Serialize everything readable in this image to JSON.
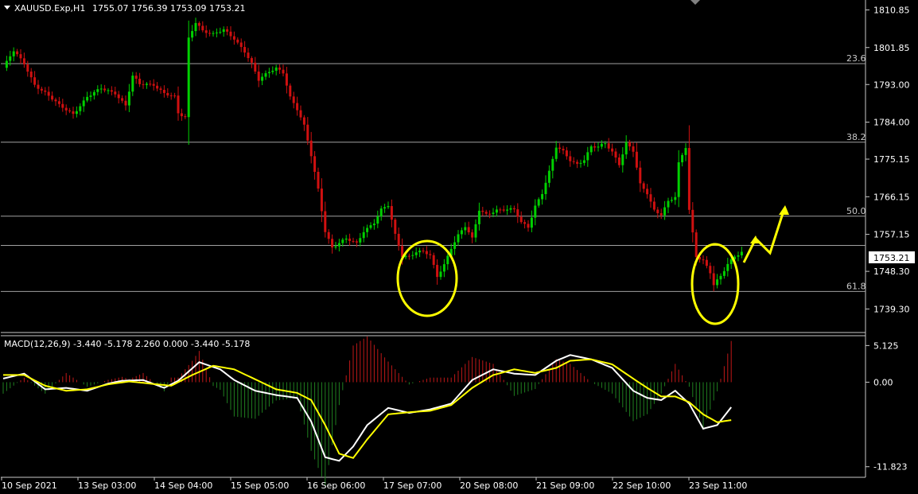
{
  "header": {
    "symbol": "XAUUSD.Exp,H1",
    "ohlc": "1755.07 1756.39 1753.09 1753.21"
  },
  "colors": {
    "background": "#000000",
    "bull": "#00d000",
    "bear": "#d01010",
    "fib_line": "#a0a0a0",
    "macd_line": "#ffffff",
    "signal_line": "#ffff00",
    "hist_pos": "#c01818",
    "hist_neg": "#208020",
    "highlight": "#ffff00",
    "price_box": "#ffffff"
  },
  "chart_data": [
    {
      "type": "candlestick",
      "title": "XAUUSD.Exp,H1",
      "y_ticks": [
        "1810.85",
        "1801.85",
        "1793.00",
        "1784.00",
        "1775.15",
        "1766.15",
        "1757.15",
        "1748.30",
        "1739.30"
      ],
      "ylim": [
        1736.9,
        1811.7
      ],
      "x_ticks": [
        "10 Sep 2021",
        "13 Sep 03:00",
        "14 Sep 04:00",
        "15 Sep 05:00",
        "16 Sep 06:00",
        "17 Sep 07:00",
        "20 Sep 08:00",
        "21 Sep 09:00",
        "22 Sep 10:00",
        "23 Sep 11:00"
      ],
      "current_price": "1753.21",
      "fib_levels": [
        {
          "label": "23.6",
          "price": 1798.0
        },
        {
          "label": "38.2",
          "price": 1779.2
        },
        {
          "label": "50.0",
          "price": 1761.5
        },
        {
          "label": "",
          "price": 1754.5
        },
        {
          "label": "61.8",
          "price": 1743.5
        }
      ],
      "anchors": [
        [
          0,
          1797
        ],
        [
          3,
          1801
        ],
        [
          6,
          1798
        ],
        [
          9,
          1793
        ],
        [
          12,
          1791
        ],
        [
          16,
          1788
        ],
        [
          20,
          1786
        ],
        [
          24,
          1790
        ],
        [
          28,
          1792
        ],
        [
          32,
          1791
        ],
        [
          35,
          1788
        ],
        [
          37,
          1795
        ],
        [
          39,
          1793
        ],
        [
          43,
          1793
        ],
        [
          46,
          1791
        ],
        [
          49,
          1790
        ],
        [
          50,
          1786
        ],
        [
          52,
          1785
        ],
        [
          53,
          1804
        ],
        [
          55,
          1808
        ],
        [
          57,
          1806
        ],
        [
          60,
          1805
        ],
        [
          63,
          1806
        ],
        [
          66,
          1804
        ],
        [
          69,
          1801
        ],
        [
          71,
          1798
        ],
        [
          73,
          1794
        ],
        [
          76,
          1796
        ],
        [
          78,
          1797
        ],
        [
          80,
          1796
        ],
        [
          82,
          1790
        ],
        [
          84,
          1787
        ],
        [
          86,
          1783
        ],
        [
          88,
          1776
        ],
        [
          90,
          1768
        ],
        [
          92,
          1758
        ],
        [
          94,
          1754
        ],
        [
          96,
          1755
        ],
        [
          98,
          1756
        ],
        [
          101,
          1755
        ],
        [
          103,
          1758
        ],
        [
          106,
          1760
        ],
        [
          108,
          1763
        ],
        [
          110,
          1764
        ],
        [
          112,
          1757
        ],
        [
          114,
          1752
        ],
        [
          116,
          1752
        ],
        [
          118,
          1753
        ],
        [
          120,
          1753
        ],
        [
          122,
          1752
        ],
        [
          124,
          1747
        ],
        [
          126,
          1750
        ],
        [
          128,
          1754
        ],
        [
          130,
          1757
        ],
        [
          132,
          1759
        ],
        [
          134,
          1756
        ],
        [
          136,
          1763
        ],
        [
          138,
          1762
        ],
        [
          141,
          1763
        ],
        [
          143,
          1763
        ],
        [
          146,
          1763
        ],
        [
          148,
          1760
        ],
        [
          150,
          1759
        ],
        [
          152,
          1764
        ],
        [
          154,
          1767
        ],
        [
          156,
          1772
        ],
        [
          158,
          1778
        ],
        [
          160,
          1777
        ],
        [
          162,
          1775
        ],
        [
          164,
          1774
        ],
        [
          166,
          1775
        ],
        [
          168,
          1778
        ],
        [
          170,
          1778
        ],
        [
          172,
          1779
        ],
        [
          174,
          1777
        ],
        [
          176,
          1774
        ],
        [
          178,
          1779
        ],
        [
          180,
          1777
        ],
        [
          182,
          1769
        ],
        [
          184,
          1767
        ],
        [
          186,
          1763
        ],
        [
          188,
          1762
        ],
        [
          190,
          1765
        ],
        [
          192,
          1766
        ],
        [
          193,
          1774
        ],
        [
          195,
          1778
        ],
        [
          196,
          1763
        ],
        [
          198,
          1752
        ],
        [
          200,
          1751
        ],
        [
          202,
          1748
        ],
        [
          203,
          1745
        ],
        [
          205,
          1747
        ],
        [
          207,
          1750
        ],
        [
          209,
          1752
        ],
        [
          211,
          1753
        ]
      ],
      "annotations": [
        {
          "type": "ellipse",
          "label": "highlight",
          "around": "17 Sep 07:00"
        },
        {
          "type": "ellipse",
          "label": "highlight",
          "around": "23 Sep 11:00"
        },
        {
          "type": "zigzag-arrow",
          "label": "projected upward move"
        }
      ]
    },
    {
      "type": "line",
      "title": "MACD(12,26,9) -3.440 -5.178 2.260 0.000 -3.440 -5.178",
      "y_ticks": [
        "5.125",
        "0.00",
        "-11.823"
      ],
      "ylim": [
        -12.3,
        5.5
      ],
      "series": [
        {
          "name": "MACD",
          "anchors": [
            [
              0,
              0.5
            ],
            [
              6,
              1.2
            ],
            [
              12,
              -1.0
            ],
            [
              18,
              -0.8
            ],
            [
              24,
              -1.2
            ],
            [
              30,
              -0.2
            ],
            [
              34,
              0.2
            ],
            [
              40,
              0.3
            ],
            [
              46,
              -0.8
            ],
            [
              50,
              0.2
            ],
            [
              56,
              2.8
            ],
            [
              62,
              1.8
            ],
            [
              66,
              0.3
            ],
            [
              72,
              -1.2
            ],
            [
              78,
              -1.8
            ],
            [
              84,
              -2.2
            ],
            [
              88,
              -5.5
            ],
            [
              92,
              -10.5
            ],
            [
              96,
              -11.0
            ],
            [
              100,
              -9.0
            ],
            [
              104,
              -6.0
            ],
            [
              110,
              -3.6
            ],
            [
              116,
              -4.3
            ],
            [
              122,
              -3.8
            ],
            [
              128,
              -3.0
            ],
            [
              134,
              0.3
            ],
            [
              140,
              1.8
            ],
            [
              146,
              1.2
            ],
            [
              152,
              1.0
            ],
            [
              158,
              3.0
            ],
            [
              162,
              3.8
            ],
            [
              168,
              3.2
            ],
            [
              174,
              2.0
            ],
            [
              180,
              -1.2
            ],
            [
              184,
              -2.2
            ],
            [
              188,
              -2.5
            ],
            [
              192,
              -1.2
            ],
            [
              196,
              -3.0
            ],
            [
              200,
              -6.5
            ],
            [
              204,
              -6.0
            ],
            [
              208,
              -3.5
            ]
          ]
        },
        {
          "name": "Signal",
          "anchors": [
            [
              0,
              1.0
            ],
            [
              6,
              1.0
            ],
            [
              12,
              -0.5
            ],
            [
              18,
              -1.2
            ],
            [
              24,
              -1.0
            ],
            [
              30,
              -0.3
            ],
            [
              36,
              0.1
            ],
            [
              42,
              -0.2
            ],
            [
              48,
              -0.5
            ],
            [
              54,
              1.0
            ],
            [
              60,
              2.3
            ],
            [
              66,
              1.8
            ],
            [
              72,
              0.4
            ],
            [
              78,
              -1.0
            ],
            [
              84,
              -1.5
            ],
            [
              88,
              -2.5
            ],
            [
              92,
              -6.0
            ],
            [
              96,
              -10.0
            ],
            [
              100,
              -10.6
            ],
            [
              104,
              -8.0
            ],
            [
              110,
              -4.5
            ],
            [
              116,
              -4.2
            ],
            [
              122,
              -4.0
            ],
            [
              128,
              -3.2
            ],
            [
              134,
              -0.8
            ],
            [
              140,
              1.0
            ],
            [
              146,
              1.8
            ],
            [
              152,
              1.3
            ],
            [
              158,
              2.0
            ],
            [
              162,
              3.0
            ],
            [
              168,
              3.2
            ],
            [
              174,
              2.5
            ],
            [
              180,
              0.5
            ],
            [
              184,
              -0.8
            ],
            [
              188,
              -2.0
            ],
            [
              192,
              -2.0
            ],
            [
              196,
              -2.8
            ],
            [
              200,
              -4.5
            ],
            [
              204,
              -5.6
            ],
            [
              208,
              -5.3
            ]
          ]
        }
      ]
    }
  ]
}
